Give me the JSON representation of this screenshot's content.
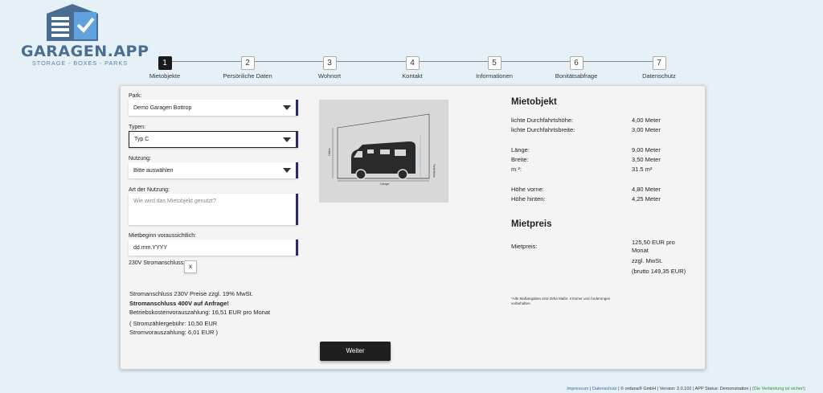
{
  "brand": {
    "name": "GARAGEN.APP",
    "tagline": "STORAGE - BOXES - PARKS",
    "colors": {
      "primary": "#4a6e93",
      "accent": "#1f1f1f"
    }
  },
  "stepper": {
    "steps": [
      {
        "num": "1",
        "label": "Mietobjekte",
        "active": true
      },
      {
        "num": "2",
        "label": "Persönliche Daten"
      },
      {
        "num": "3",
        "label": "Wohnort"
      },
      {
        "num": "4",
        "label": "Kontakt"
      },
      {
        "num": "5",
        "label": "Informationen"
      },
      {
        "num": "6",
        "label": "Bonitätsabfrage"
      },
      {
        "num": "7",
        "label": "Datenschutz"
      }
    ]
  },
  "form": {
    "park_label": "Park:",
    "park_value": "Demo Garagen Bottrop",
    "typen_label": "Typen:",
    "typen_value": "Typ C",
    "nutzung_label": "Nutzung:",
    "nutzung_value": "Bitte auswählen",
    "art_label": "Art der Nutzung:",
    "art_placeholder": "Wie wird das Mietobjekt genutzt?",
    "mietbeginn_label": "Mietbeginn voraussichtlich:",
    "mietbeginn_value": "dd.mm.YYYY",
    "strom_label": "230V Stromanschluss:",
    "strom_value": "x",
    "info_line1": "Stromanschluss 230V Preise zzgl. 19% MwSt.",
    "info_line2": "Stromanschluss 400V auf Anfrage!",
    "info_line3": "Betriebskostenvorauszahlung: 16,51 EUR pro Monat",
    "info_line4": "( Stromzählergebühr: 10,50 EUR",
    "info_line5": "Stromvorauszahlung: 6,01 EUR )",
    "weiter_label": "Weiter"
  },
  "diagram": {
    "hoehe_label": "Höhe",
    "laenge_label": "Länge",
    "tiefe_label": "Tiefe/Höhe"
  },
  "mietobjekt": {
    "title": "Mietobjekt",
    "rows": [
      {
        "label": "lichte Durchfahrtshöhe:",
        "value": "4,00 Meter"
      },
      {
        "label": "lichte Durchfahrtsbreite:",
        "value": "3,00 Meter"
      },
      {
        "label": "Länge:",
        "value": "9,00 Meter"
      },
      {
        "label": "Breite:",
        "value": "3,50 Meter"
      },
      {
        "label": "m ²:",
        "value": "31.5 m²"
      },
      {
        "label": "Höhe vorne:",
        "value": "4,80 Meter"
      },
      {
        "label": "Höhe hinten:",
        "value": "4,25 Meter"
      }
    ]
  },
  "mietpreis": {
    "title": "Mietpreis",
    "label": "Mietpreis:",
    "value1": "125,50 EUR pro",
    "value2": "Monat",
    "value3": "zzgl. MwSt.",
    "value4": "(brutto 149,35 EUR)",
    "note1": "*Alle Maßangaben sind Zirka Maße. Irrtümer und Änderungen",
    "note2": "vorbehalten."
  },
  "footer": {
    "impressum": "Impressum",
    "sep1": " | ",
    "datenschutz": "Datenschutz",
    "rest": " | © ordana® GmbH | Version: 2.0.102 | APP Status: Demonstration | ",
    "secure": "(Die Verbindung ist sicher!)"
  }
}
